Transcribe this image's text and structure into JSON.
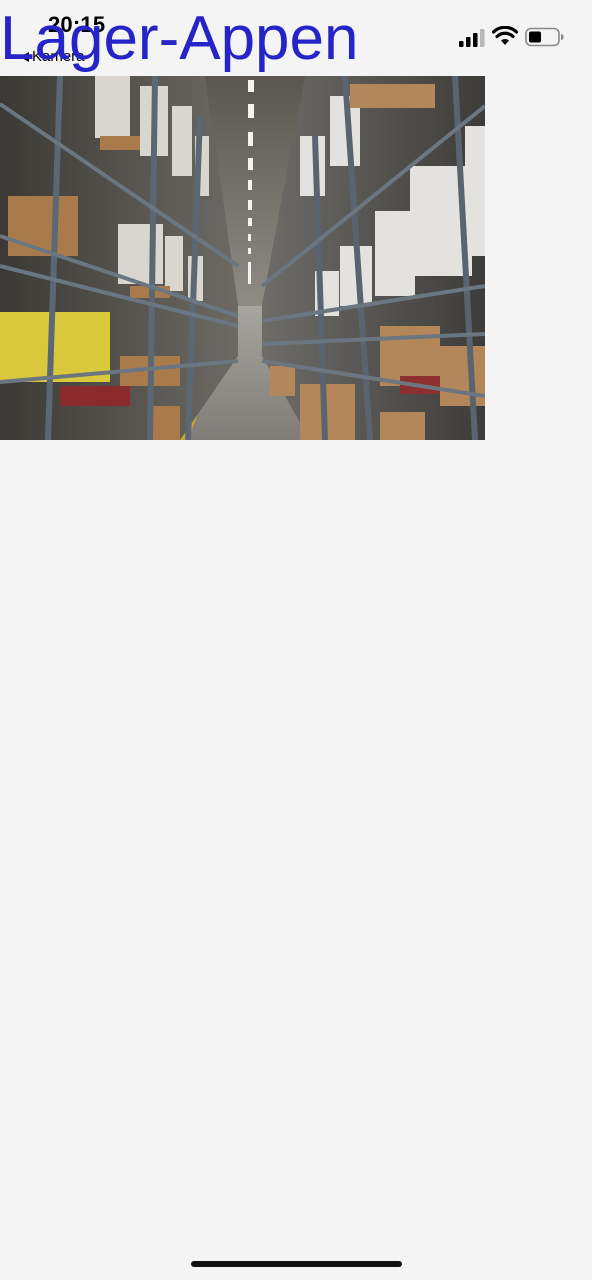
{
  "status_bar": {
    "time": "20:15",
    "back_label": "Kamera"
  },
  "app": {
    "title": "Lager-Appen",
    "title_color": "#2424c8"
  },
  "content": {
    "image_subject": "warehouse-aisle-photo"
  },
  "icons": [
    "signal-icon",
    "wifi-icon",
    "battery-icon",
    "back-arrow-icon"
  ]
}
